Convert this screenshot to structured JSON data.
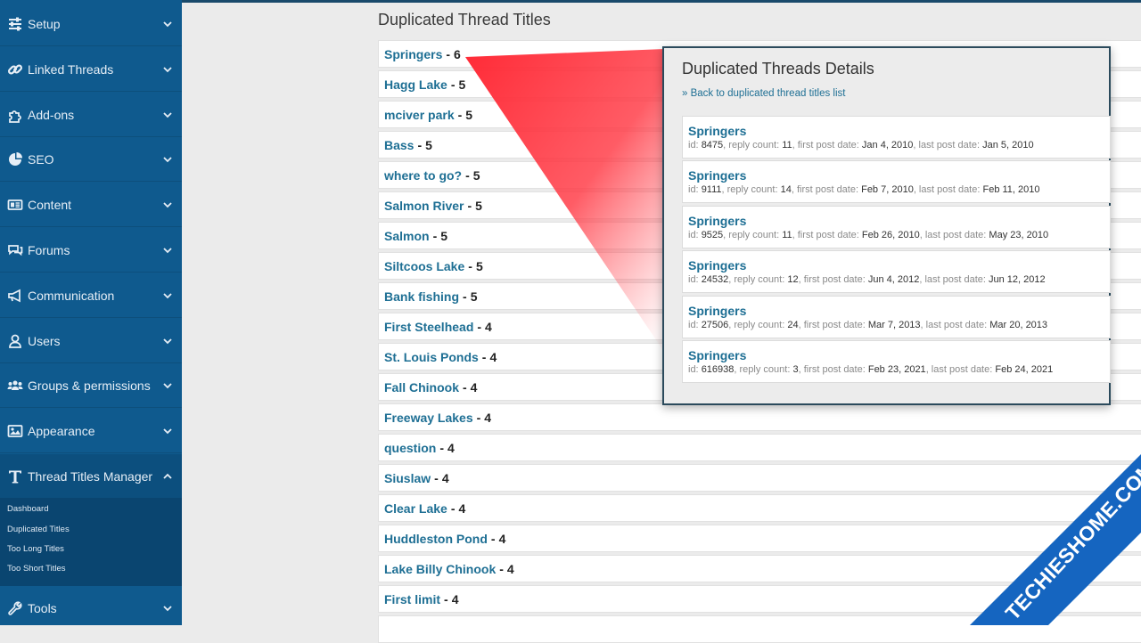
{
  "sidebar": {
    "items": [
      {
        "label": "Setup",
        "icon": "sliders-icon"
      },
      {
        "label": "Linked Threads",
        "icon": "link-icon"
      },
      {
        "label": "Add-ons",
        "icon": "puzzle-icon"
      },
      {
        "label": "SEO",
        "icon": "pie-chart-icon"
      },
      {
        "label": "Content",
        "icon": "newspaper-icon"
      },
      {
        "label": "Forums",
        "icon": "comments-icon"
      },
      {
        "label": "Communication",
        "icon": "bullhorn-icon"
      },
      {
        "label": "Users",
        "icon": "user-icon"
      },
      {
        "label": "Groups & permissions",
        "icon": "users-icon"
      },
      {
        "label": "Appearance",
        "icon": "image-icon"
      },
      {
        "label": "Thread Titles Manager",
        "icon": "text-t-icon"
      },
      {
        "label": "Tools",
        "icon": "wrench-icon"
      }
    ],
    "subitems": [
      "Dashboard",
      "Duplicated Titles",
      "Too Long Titles",
      "Too Short Titles"
    ]
  },
  "main": {
    "title": "Duplicated Thread Titles",
    "separator": "-",
    "rows": [
      {
        "title": "Springers",
        "count": "6"
      },
      {
        "title": "Hagg Lake",
        "count": "5"
      },
      {
        "title": "mciver park",
        "count": "5"
      },
      {
        "title": "Bass",
        "count": "5"
      },
      {
        "title": "where to go?",
        "count": "5"
      },
      {
        "title": "Salmon River",
        "count": "5"
      },
      {
        "title": "Salmon",
        "count": "5"
      },
      {
        "title": "Siltcoos Lake",
        "count": "5"
      },
      {
        "title": "Bank fishing",
        "count": "5"
      },
      {
        "title": "First Steelhead",
        "count": "4"
      },
      {
        "title": "St. Louis Ponds",
        "count": "4"
      },
      {
        "title": "Fall Chinook",
        "count": "4"
      },
      {
        "title": "Freeway Lakes",
        "count": "4"
      },
      {
        "title": "question",
        "count": "4"
      },
      {
        "title": "Siuslaw",
        "count": "4"
      },
      {
        "title": "Clear Lake",
        "count": "4"
      },
      {
        "title": "Huddleston Pond",
        "count": "4"
      },
      {
        "title": "Lake Billy Chinook",
        "count": "4"
      },
      {
        "title": "First limit",
        "count": "4"
      }
    ]
  },
  "popup": {
    "title": "Duplicated Threads Details",
    "back_link": "» Back to duplicated thread titles list",
    "labels": {
      "id": "id:",
      "reply_count": ", reply count:",
      "first_post": ", first post date:",
      "last_post": ", last post date:"
    },
    "threads": [
      {
        "title": "Springers",
        "id": "8475",
        "reply_count": "11",
        "first_post": "Jan 4, 2010",
        "last_post": "Jan 5, 2010"
      },
      {
        "title": "Springers",
        "id": "9111",
        "reply_count": "14",
        "first_post": "Feb 7, 2010",
        "last_post": "Feb 11, 2010"
      },
      {
        "title": "Springers",
        "id": "9525",
        "reply_count": "11",
        "first_post": "Feb 26, 2010",
        "last_post": "May 23, 2010"
      },
      {
        "title": "Springers",
        "id": "24532",
        "reply_count": "12",
        "first_post": "Jun 4, 2012",
        "last_post": "Jun 12, 2012"
      },
      {
        "title": "Springers",
        "id": "27506",
        "reply_count": "24",
        "first_post": "Mar 7, 2013",
        "last_post": "Mar 20, 2013"
      },
      {
        "title": "Springers",
        "id": "616938",
        "reply_count": "3",
        "first_post": "Feb 23, 2021",
        "last_post": "Feb 24, 2021"
      }
    ]
  },
  "watermark": {
    "text": "TECHIESHOME.COM"
  },
  "colors": {
    "sidebar_bg": "#0f5a8e",
    "submenu_bg": "#0a4570",
    "link": "#1e6f94",
    "beam": "#ff2a36",
    "watermark": "#1565c0"
  }
}
